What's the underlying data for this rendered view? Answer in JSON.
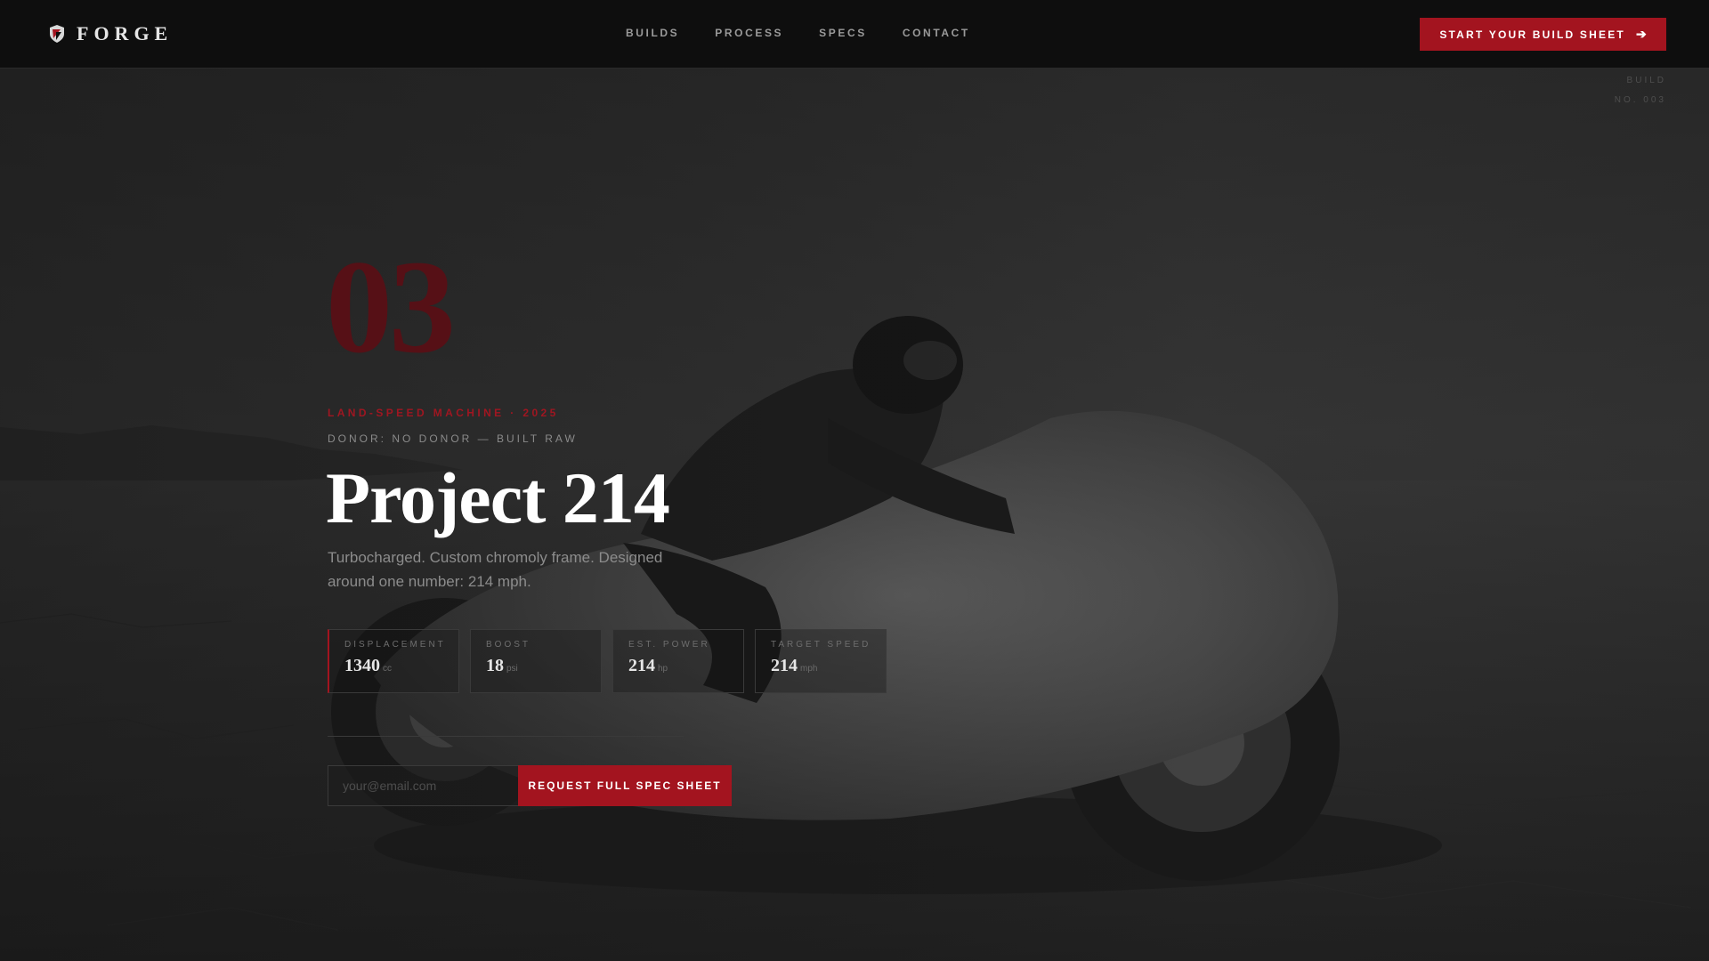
{
  "brand": {
    "name": "FORGE",
    "logo_icon": "shield-stripes-icon",
    "accent_color": "#a3141f"
  },
  "nav": {
    "items": [
      "BUILDS",
      "PROCESS",
      "SPECS",
      "CONTACT"
    ],
    "cta_label": "START YOUR BUILD SHEET",
    "cta_icon": "arrow-right-icon"
  },
  "build_tag": {
    "label": "BUILD",
    "number": "NO. 003"
  },
  "hero": {
    "big_number": "03",
    "kicker": "LAND-SPEED MACHINE · 2025",
    "donor": "DONOR: NO DONOR — BUILT RAW",
    "title": "Project 214",
    "description": "Turbocharged. Custom chromoly frame. Designed around one number: 214 mph.",
    "background": "rider-on-streamlined-motorcycle-salt-flat"
  },
  "stats": [
    {
      "label": "DISPLACEMENT",
      "value": "1340",
      "unit": "cc"
    },
    {
      "label": "BOOST",
      "value": "18",
      "unit": "psi"
    },
    {
      "label": "EST. POWER",
      "value": "214",
      "unit": "hp"
    },
    {
      "label": "TARGET SPEED",
      "value": "214",
      "unit": "mph"
    }
  ],
  "signup": {
    "email_placeholder": "your@email.com",
    "email_value": "",
    "submit_label": "REQUEST FULL SPEC SHEET"
  }
}
